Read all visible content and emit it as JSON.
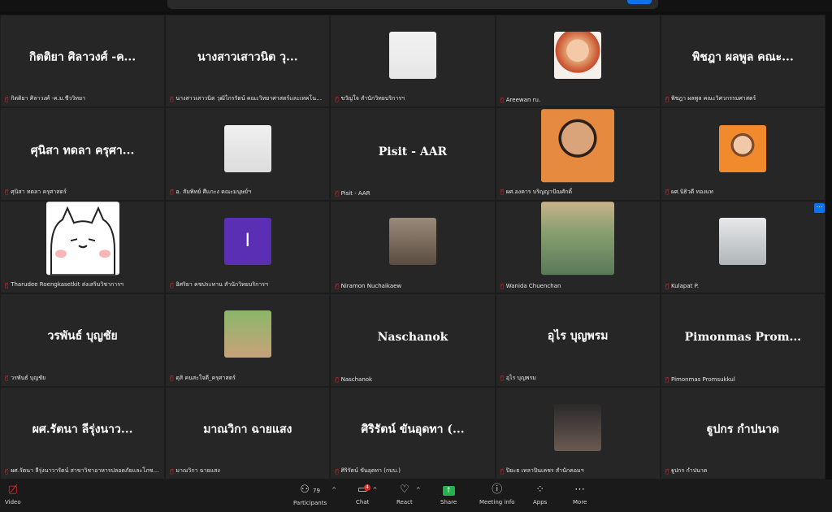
{
  "tiles": [
    {
      "big": "กิตติยา ศิลาวงศ์ -ค...",
      "label": "กิตติยา ศิลาวงศ์ -ค.ม.ชีววิทยา",
      "photo": null
    },
    {
      "big": "นางสาวเสาวนิต วุ...",
      "label": "นางสาวเสาวนิต วุฒิไกรรัตน์ คณะวิทยาศาสตร์และเทคโนโลยี",
      "photo": null
    },
    {
      "big": "",
      "label": "ขวัญใจ สำนักวิทยบริการฯ",
      "photo": "p1"
    },
    {
      "big": "",
      "label": "Areewan ru.",
      "photo": "p2"
    },
    {
      "big": "พิชฎา ผลพูล คณะ...",
      "label": "พิชฎา ผลพูล คณะวิศวกรรมศาสตร์",
      "photo": null
    },
    {
      "big": "ศุนิสา ทดลา ครุศา...",
      "label": "ศุนิสา ทดลา ครุศาสตร์",
      "photo": null
    },
    {
      "big": "",
      "label": "อ. สัมพิทย์ ศีแกะง คณะมนุษย์ฯ",
      "photo": "p3"
    },
    {
      "big": "Pisit - AAR",
      "label": "Pisit - AAR",
      "photo": null
    },
    {
      "big": "",
      "label": "ผศ.องคาร บริญญาปัณศักดิ์",
      "photo": "p4"
    },
    {
      "big": "",
      "label": "ผศ.นิธิวดี ทองแท",
      "photo": "p5"
    },
    {
      "big": "",
      "label": "Tharudee Roengkasetkit ส่งเสริมวิชาการฯ",
      "photo": "p6"
    },
    {
      "big": "",
      "label": "อิศริยา คชประทาน สำนักวิทยบริการฯ",
      "photo": "initial",
      "initial": "I"
    },
    {
      "big": "",
      "label": "Niramon Nuchaikaew",
      "photo": "p7"
    },
    {
      "big": "",
      "label": "Wanida Chuenchan",
      "photo": "p8"
    },
    {
      "big": "",
      "label": "Kulapat P.",
      "photo": "p9"
    },
    {
      "big": "วรพันธ์ บุญชัย",
      "label": "วรพันธ์ บุญชัย",
      "photo": null
    },
    {
      "big": "",
      "label": "ดุสิ คนสะใจดี_ครุศาสตร์",
      "photo": "p10"
    },
    {
      "big": "Naschanok",
      "label": "Naschanok",
      "photo": null
    },
    {
      "big": "อุไร บุญพรม",
      "label": "อุไร บุญพรม",
      "photo": null
    },
    {
      "big": "Pimonmas Prom...",
      "label": "Pimonmas Promsukkul",
      "photo": null
    },
    {
      "big": "ผศ.รัตนา ลีรุ่งนาว...",
      "label": "ผศ.รัตนา ลีรุ่งนาวารัตน์ สาขาวิชาอาหารปลอดภัยและโภชนาการ",
      "photo": null
    },
    {
      "big": "มาณวิกา ฉายแสง",
      "label": "มาณวิกา ฉายแสง",
      "photo": null
    },
    {
      "big": "ศิริรัตน์ ขันอุดทา (...",
      "label": "ศิริรัตน์ ขันอุดทา (กบบ.)",
      "photo": null
    },
    {
      "big": "",
      "label": "ปิยะธ เทลาปินเคชร สำนักคอมฯ",
      "photo": "p11"
    },
    {
      "big": "ฐูปกร กำปนาด",
      "label": "ฐูปกร กำปนาด",
      "photo": null
    }
  ],
  "toolbar": {
    "video": "Video",
    "participants": "Participants",
    "participants_count": "79",
    "chat": "Chat",
    "chat_badge": "4",
    "react": "React",
    "share": "Share",
    "meeting_info": "Meeting info",
    "apps": "Apps",
    "more": "More"
  },
  "colors": {
    "accent": "#0e72ed",
    "muted": "#e02828",
    "share": "#23b24b",
    "initial_bg": "#5b2fb3"
  }
}
